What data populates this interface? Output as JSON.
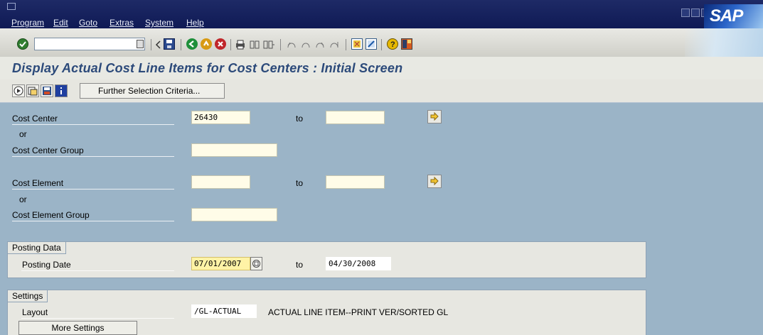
{
  "menu": {
    "items": [
      "Program",
      "Edit",
      "Goto",
      "Extras",
      "System",
      "Help"
    ],
    "logo": "SAP"
  },
  "toolbar": {
    "command_field_value": "",
    "icons": [
      "enter-icon",
      "command-dropdown-icon",
      "back-small-icon",
      "save-icon",
      "back-icon",
      "exit-icon",
      "cancel-icon",
      "print-icon",
      "find-icon",
      "find-next-icon",
      "first-page-icon",
      "previous-page-icon",
      "next-page-icon",
      "last-page-icon",
      "new-session-icon",
      "shortcut-icon",
      "help-icon",
      "layout-icon"
    ]
  },
  "title": "Display Actual Cost Line Items for Cost Centers : Initial Screen",
  "app_toolbar": {
    "icons": [
      "execute-icon",
      "get-variant-icon",
      "save-variant-icon",
      "info-icon",
      "selection-criteria-icon"
    ],
    "further_selection_label": "Further Selection Criteria..."
  },
  "form": {
    "cost_center_label": "Cost Center",
    "cost_center_value": "26430",
    "cost_center_to_label": "to",
    "cost_center_to_value": "",
    "or1": "or",
    "cost_center_group_label": "Cost Center Group",
    "cost_center_group_value": "",
    "cost_element_label": "Cost Element",
    "cost_element_value": "",
    "cost_element_to_label": "to",
    "cost_element_to_value": "",
    "or2": "or",
    "cost_element_group_label": "Cost Element Group",
    "cost_element_group_value": ""
  },
  "posting": {
    "frame_title": "Posting Data",
    "date_label": "Posting Date",
    "date_from": "07/01/2007",
    "to_label": "to",
    "date_to": "04/30/2008"
  },
  "settings": {
    "frame_title": "Settings",
    "layout_label": "Layout",
    "layout_value": "/GL-ACTUAL",
    "layout_desc": "ACTUAL LINE ITEM--PRINT VER/SORTED GL",
    "more_settings_label": "More Settings"
  },
  "colors": {
    "menubar": "#1e2a66",
    "body": "#9bb4c7",
    "title_text": "#2c4a7a",
    "input_bg": "#fffce8",
    "highlight": "#fff3a6"
  }
}
